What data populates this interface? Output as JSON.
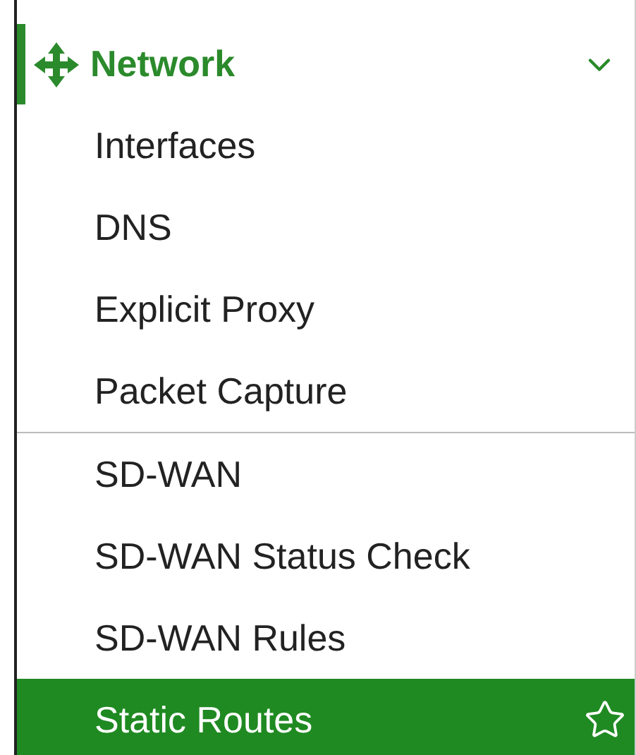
{
  "menu": {
    "title": "Network",
    "expanded": true,
    "groups": [
      [
        {
          "label": "Interfaces",
          "selected": false
        },
        {
          "label": "DNS",
          "selected": false
        },
        {
          "label": "Explicit Proxy",
          "selected": false
        },
        {
          "label": "Packet Capture",
          "selected": false
        }
      ],
      [
        {
          "label": "SD-WAN",
          "selected": false
        },
        {
          "label": "SD-WAN Status Check",
          "selected": false
        },
        {
          "label": "SD-WAN Rules",
          "selected": false
        },
        {
          "label": "Static Routes",
          "selected": true
        }
      ]
    ]
  }
}
